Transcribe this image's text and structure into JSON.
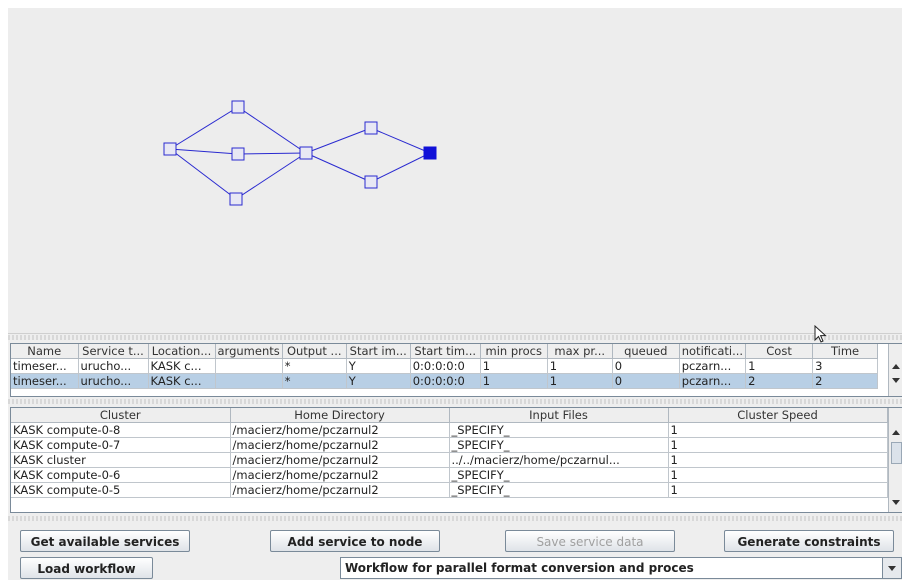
{
  "services_table": {
    "columns": [
      "Name",
      "Service t...",
      "Location...",
      "arguments",
      "Output ...",
      "Start im...",
      "Start tim...",
      "min procs",
      "max pr...",
      "queued",
      "notificati...",
      "Cost",
      "Time"
    ],
    "rows": [
      [
        "timeser...",
        "urucho...",
        "KASK c...",
        "",
        "*",
        "Y",
        "0:0:0:0:0",
        "1",
        "1",
        "0",
        "pczarn...",
        "1",
        "3"
      ],
      [
        "timeser...",
        "urucho...",
        "KASK c...",
        "",
        "*",
        "Y",
        "0:0:0:0:0",
        "1",
        "1",
        "0",
        "pczarn...",
        "2",
        "2"
      ]
    ],
    "selected_row": 1
  },
  "clusters_table": {
    "columns": [
      "Cluster",
      "Home Directory",
      "Input Files",
      "Cluster Speed"
    ],
    "rows": [
      [
        "KASK compute-0-8",
        "/macierz/home/pczarnul2",
        "_SPECIFY_",
        "1"
      ],
      [
        "KASK compute-0-7",
        "/macierz/home/pczarnul2",
        "_SPECIFY_",
        "1"
      ],
      [
        "KASK cluster",
        "/macierz/home/pczarnul2",
        "../../macierz/home/pczarnul...",
        "1"
      ],
      [
        "KASK compute-0-6",
        "/macierz/home/pczarnul2",
        "_SPECIFY_",
        "1"
      ],
      [
        "KASK compute-0-5",
        "/macierz/home/pczarnul2",
        "_SPECIFY_",
        "1"
      ]
    ]
  },
  "buttons": {
    "get_services": "Get available services",
    "add_service": "Add service to node",
    "save_service": "Save service data",
    "generate_constraints": "Generate constraints",
    "load_workflow": "Load workflow"
  },
  "workflow_select": {
    "value": "Workflow for parallel format conversion and proces"
  },
  "colors": {
    "graph": "#2a2ad0",
    "end_node": "#1010d8",
    "selection": "#b8cfe5"
  }
}
